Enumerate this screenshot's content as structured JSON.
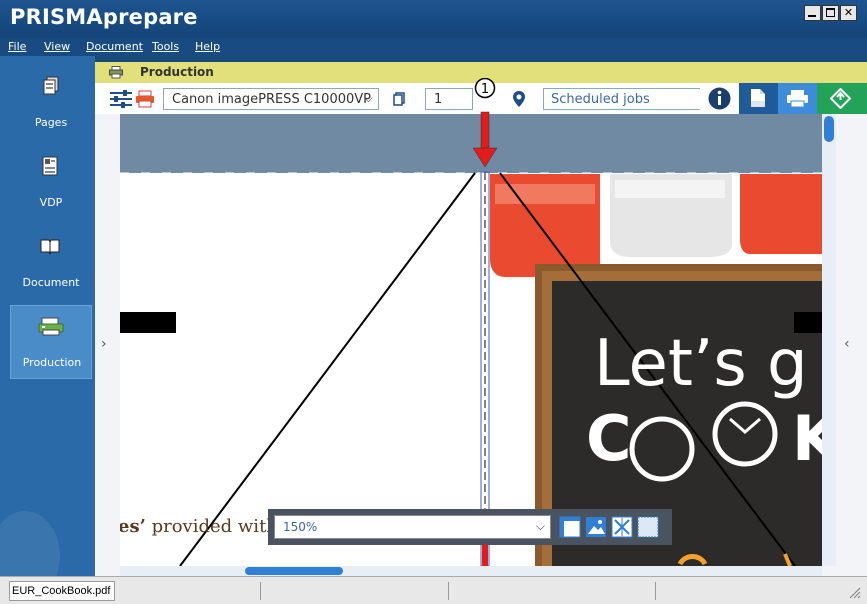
{
  "app": {
    "title": "PRISMAprepare"
  },
  "menu": {
    "items": [
      "File",
      "View",
      "Document",
      "Tools",
      "Help"
    ]
  },
  "sidebar": {
    "items": [
      {
        "label": "Pages",
        "icon": "pages-icon"
      },
      {
        "label": "VDP",
        "icon": "vdp-icon"
      },
      {
        "label": "Document",
        "icon": "document-icon"
      },
      {
        "label": "Production",
        "icon": "production-icon",
        "active": true
      }
    ]
  },
  "production": {
    "title": "Production"
  },
  "toolbar": {
    "printer": "Canon imagePRESS C10000VP",
    "copies": "1",
    "destination": "Scheduled jobs"
  },
  "callout": {
    "number": "1"
  },
  "page_content": {
    "bottom_text_bold": "es’",
    "bottom_text": "provided with",
    "chalk_line1": "Let’s g",
    "chalk_line2": "C",
    "chalk_line2b": "K"
  },
  "zoom": {
    "value": "150%"
  },
  "status": {
    "filename": "EUR_CookBook.pdf"
  },
  "colors": {
    "accent": "#2f7fd4",
    "header": "#e2e07a",
    "title_bar": "#174b82",
    "sidebar": "#2a6aa8",
    "print_green": "#23a35a"
  }
}
